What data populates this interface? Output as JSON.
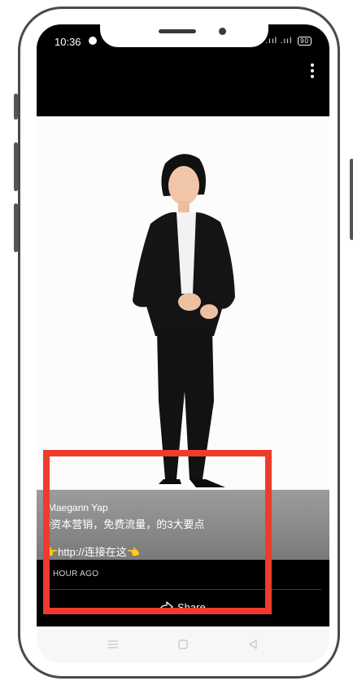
{
  "status_bar": {
    "time": "10:36",
    "signal": ".ııl .ııl",
    "battery": "90"
  },
  "post": {
    "author": "Maegann Yap",
    "caption": "0资本营销，免费流量，的3大要点",
    "link_text": "👉http://连接在这👈",
    "time_ago": "HOUR AGO",
    "share_label": "Share"
  },
  "colors": {
    "highlight": "#ef3b2d",
    "suit": "#141414",
    "bar": "#000000"
  },
  "icons": [
    "message-icon",
    "more-options-icon",
    "share-icon",
    "menu-icon",
    "home-icon",
    "back-icon"
  ]
}
